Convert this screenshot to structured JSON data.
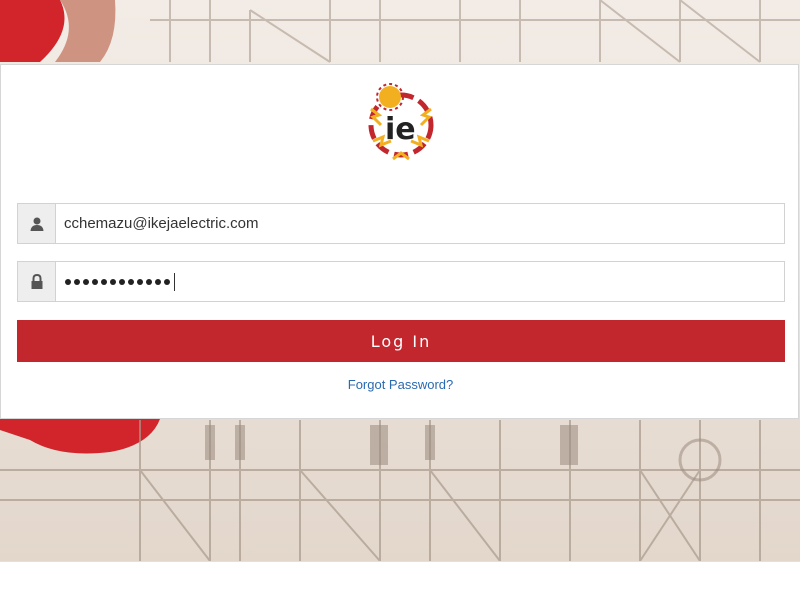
{
  "login": {
    "email_value": "cchemazu@ikejaelectric.com",
    "password_mask_count": 12,
    "login_label": "Log In",
    "forgot_label": "Forgot Password?"
  },
  "logo": {
    "text": "ie"
  },
  "colors": {
    "brand_red": "#c1272d",
    "link_blue": "#2a6ab0",
    "logo_yellow": "#f2b021"
  },
  "icons": {
    "user": "user-icon",
    "password": "lock-icon"
  }
}
